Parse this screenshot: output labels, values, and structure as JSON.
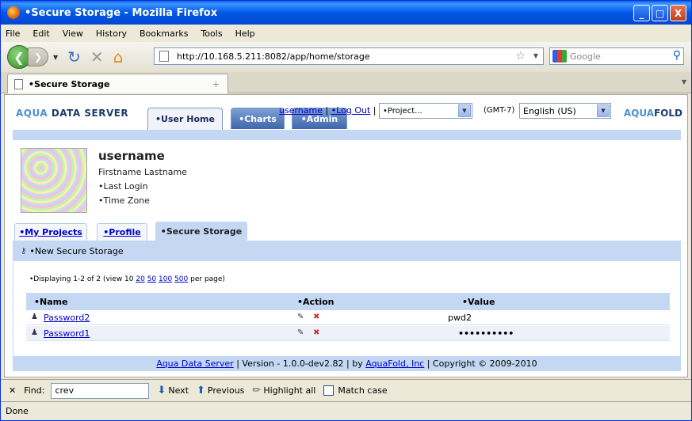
{
  "window": {
    "title": "•Secure Storage - Mozilla Firefox",
    "min": "_",
    "max": "□",
    "close": "X"
  },
  "menu": [
    "File",
    "Edit",
    "View",
    "History",
    "Bookmarks",
    "Tools",
    "Help"
  ],
  "nav": {
    "url": "http://10.168.5.211:8082/app/home/storage",
    "search_placeholder": "Google"
  },
  "tab": {
    "title": "•Secure Storage",
    "new_tab": "+"
  },
  "app": {
    "logo_left_prefix": "AQUA",
    "logo_left_suffix": " DATA SERVER",
    "logo_right_prefix": "AQUA",
    "logo_right_suffix": "FOLD",
    "tabs": {
      "user_home": "•User Home",
      "charts": "•Charts",
      "admin": "•Admin"
    },
    "username_link": "username",
    "separator": " | ",
    "logout": "•Log Out",
    "project_select": "•Project...",
    "timezone": "(GMT-7)",
    "language": "English (US)"
  },
  "profile": {
    "username": "username",
    "fullname": "Firstname Lastname",
    "last_login": "•Last Login",
    "time_zone": "•Time Zone"
  },
  "subtabs": {
    "projects": "•My Projects",
    "profile": "•Profile",
    "storage": "•Secure Storage"
  },
  "new_storage": "•New Secure Storage",
  "pager": {
    "prefix": "•Displaying 1-2 of 2 (view 10 ",
    "opt1": "20",
    "opt2": "50",
    "opt3": "100",
    "opt4": "500",
    "suffix": " per page)"
  },
  "table": {
    "headers": {
      "name": "•Name",
      "action": "•Action",
      "value": "•Value"
    },
    "rows": [
      {
        "name": "Password2",
        "value": "pwd2"
      },
      {
        "name": "Password1",
        "value": "••••••••••"
      }
    ]
  },
  "footer": {
    "app": "Aqua Data Server",
    "version": " | Version - 1.0.0-dev2.82 | by ",
    "company": "AquaFold, Inc",
    "copyright": " | Copyright © 2009-2010"
  },
  "find": {
    "label": "Find:",
    "value": "crev",
    "next": "Next",
    "previous": "Previous",
    "highlight": "Highlight all",
    "match_case": "Match case",
    "close": "✕"
  },
  "status": "Done"
}
